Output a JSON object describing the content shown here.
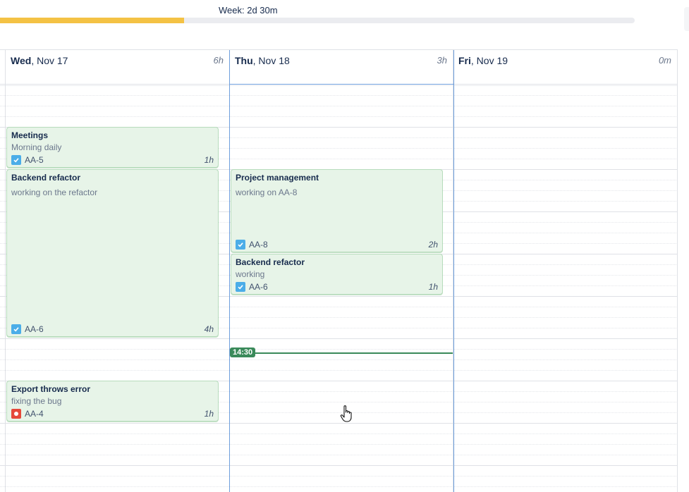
{
  "week": {
    "label": "Week: 2d 30m",
    "progress": 0.29
  },
  "days": [
    {
      "name": "Wed",
      "date": ", Nov 17",
      "total": "6h"
    },
    {
      "name": "Thu",
      "date": ", Nov 18",
      "total": "3h"
    },
    {
      "name": "Fri",
      "date": ", Nov 19",
      "total": "0m"
    }
  ],
  "events": [
    {
      "title": "Meetings",
      "description": "Morning daily",
      "issue": "AA-5",
      "issue_type": "task",
      "duration": "1h"
    },
    {
      "title": "Backend refactor",
      "description": "working on the refactor",
      "issue": "AA-6",
      "issue_type": "task",
      "duration": "4h"
    },
    {
      "title": "Export throws error",
      "description": "fixing the bug",
      "issue": "AA-4",
      "issue_type": "bug",
      "duration": "1h"
    },
    {
      "title": "Project management",
      "description": "working on AA-8",
      "issue": "AA-8",
      "issue_type": "task",
      "duration": "2h"
    },
    {
      "title": "Backend refactor",
      "description": "working",
      "issue": "AA-6",
      "issue_type": "task",
      "duration": "1h"
    }
  ],
  "current_time": "14:30",
  "colors": {
    "accent": "#4c9aff",
    "event_bg": "#e7f4e8",
    "now": "#3a8a5a",
    "progress": "#f4c244",
    "task_icon": "#4bade8",
    "bug_icon": "#e5493a"
  }
}
